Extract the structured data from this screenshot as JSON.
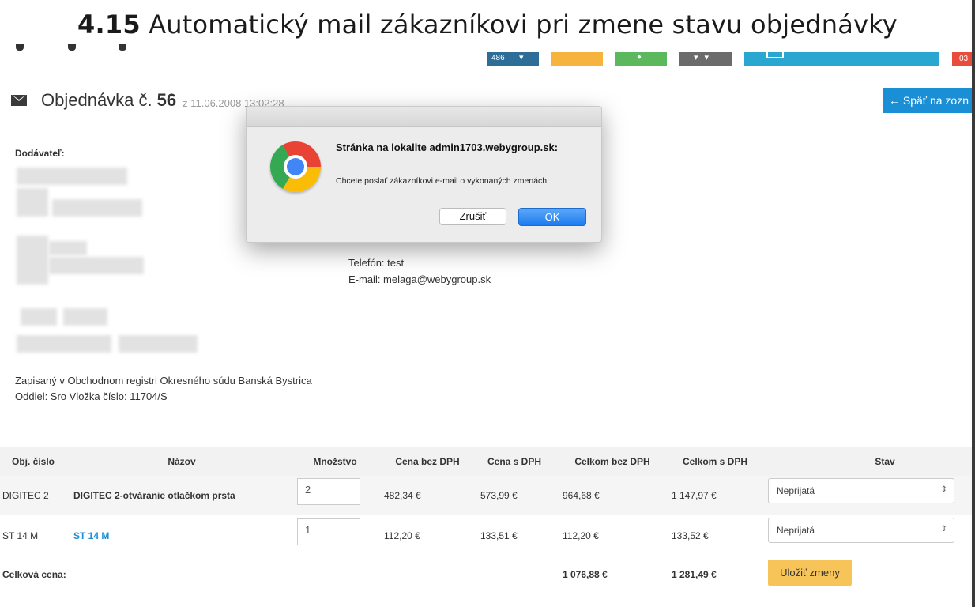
{
  "heading": {
    "number": "4.15",
    "title": "Automatický mail zákazníkovi pri zmene stavu objednávky"
  },
  "top_tiles": {
    "badge_count": "486",
    "red_tile_text": "03:"
  },
  "order": {
    "label": "Objednávka č.",
    "number": "56",
    "date": "z 11.06.2008 13:02:28"
  },
  "back_button": {
    "label": "← Späť na zozn"
  },
  "supplier": {
    "label": "Dodávateľ:",
    "registration": "Zapisaný v Obchodnom registri Okresného súdu Banská Bystrica Oddiel: Sro Vložka číslo: 11704/S"
  },
  "customer": {
    "phone": "Telefón: test",
    "email": "E-mail: melaga@webygroup.sk"
  },
  "dialog": {
    "title": "Stránka na lokalite admin1703.webygroup.sk:",
    "message": "Chcete poslať zákazníkovi e-mail o vykonaných zmenách",
    "cancel_label": "Zrušiť",
    "ok_label": "OK"
  },
  "table": {
    "columns": [
      "Obj. číslo",
      "Názov",
      "Množstvo",
      "Cena bez DPH",
      "Cena s DPH",
      "Celkom bez DPH",
      "Celkom s DPH",
      "Stav"
    ],
    "rows": [
      {
        "code": "DIGITEC 2",
        "name": "DIGITEC 2-otváranie otlačkom prsta",
        "qty": "2",
        "price": "482,34 €",
        "price_vat": "573,99 €",
        "total": "964,68 €",
        "total_vat": "1 147,97 €",
        "status": "Neprijatá"
      },
      {
        "code": "ST 14 M",
        "name": "ST 14 M",
        "qty": "1",
        "price": "112,20 €",
        "price_vat": "133,51 €",
        "total": "112,20 €",
        "total_vat": "133,52 €",
        "status": "Neprijatá"
      }
    ],
    "total_label": "Celková cena:",
    "grand_total": "1 076,88 €",
    "grand_total_vat": "1 281,49 €",
    "save_label": "Uložiť zmeny"
  },
  "colors": {
    "accent_blue": "#1a8fd6",
    "save_yellow": "#f7c45a",
    "ok_blue": "#1a7cf0"
  }
}
